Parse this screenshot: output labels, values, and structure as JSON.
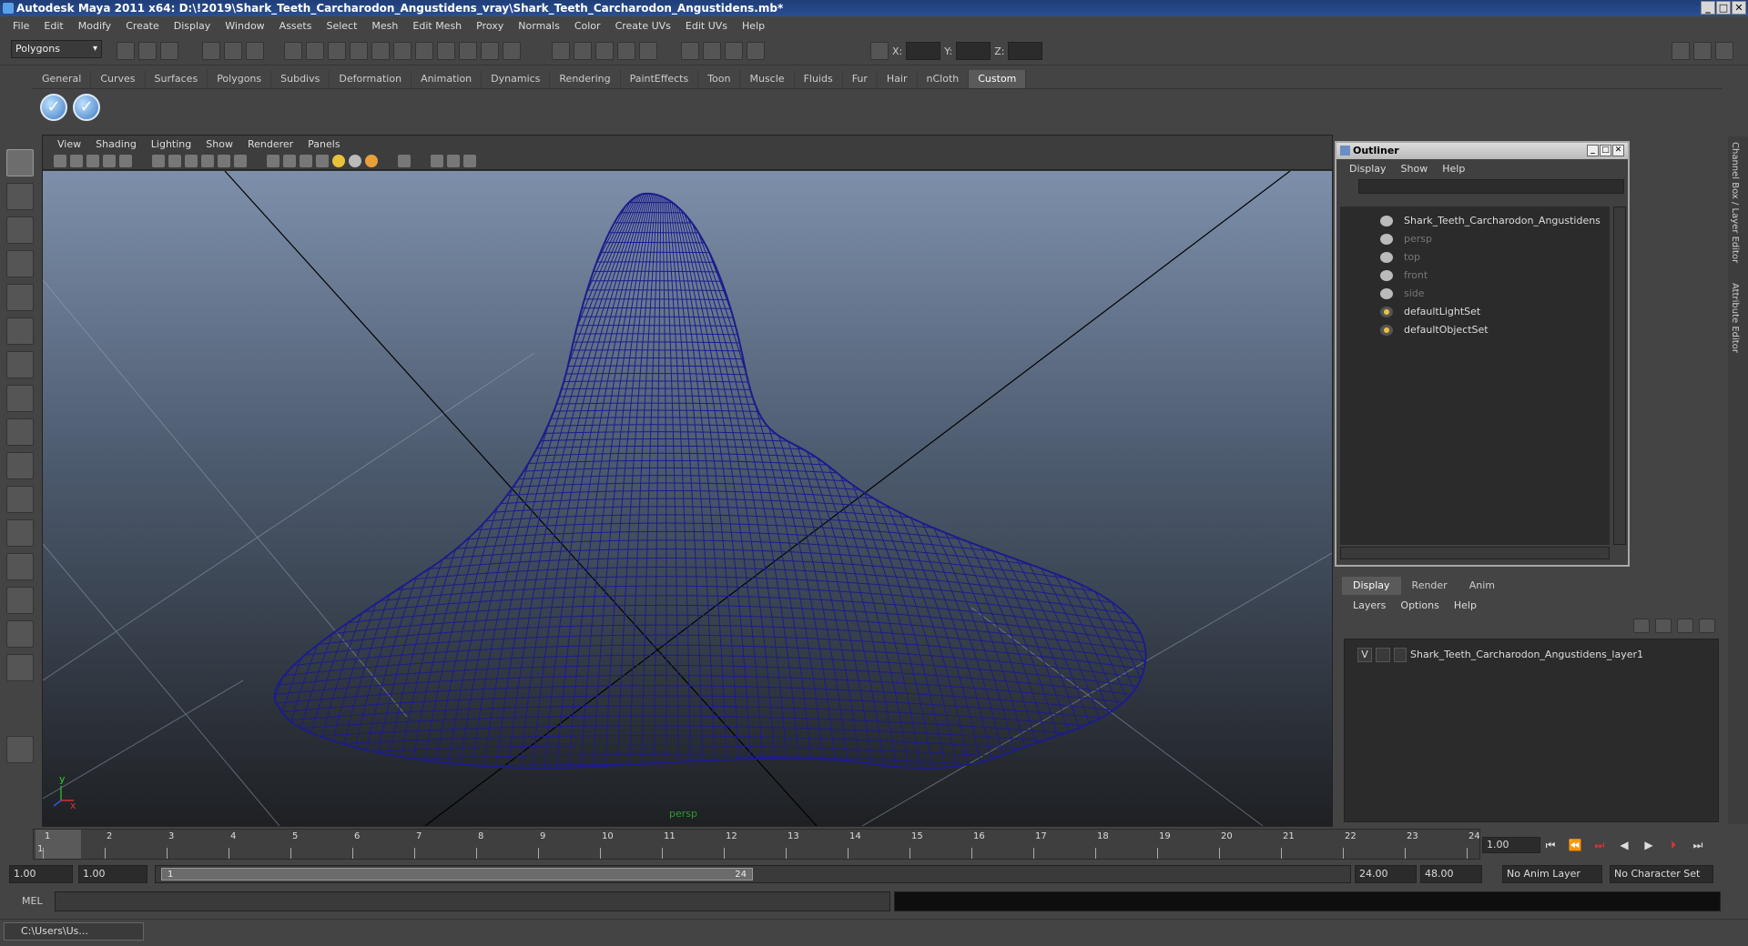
{
  "window": {
    "title": "Autodesk Maya 2011 x64: D:\\!2019\\Shark_Teeth_Carcharodon_Angustidens_vray\\Shark_Teeth_Carcharodon_Angustidens.mb*",
    "min": "_",
    "max": "□",
    "close": "✕"
  },
  "menubar": [
    "File",
    "Edit",
    "Modify",
    "Create",
    "Display",
    "Window",
    "Assets",
    "Select",
    "Mesh",
    "Edit Mesh",
    "Proxy",
    "Normals",
    "Color",
    "Create UVs",
    "Edit UVs",
    "Help"
  ],
  "statusline": {
    "mode": "Polygons",
    "x_label": "X:",
    "y_label": "Y:",
    "z_label": "Z:"
  },
  "shelf": {
    "tabs": [
      "General",
      "Curves",
      "Surfaces",
      "Polygons",
      "Subdivs",
      "Deformation",
      "Animation",
      "Dynamics",
      "Rendering",
      "PaintEffects",
      "Toon",
      "Muscle",
      "Fluids",
      "Fur",
      "Hair",
      "nCloth",
      "Custom"
    ],
    "active_tab": "Custom"
  },
  "viewport": {
    "menu": [
      "View",
      "Shading",
      "Lighting",
      "Show",
      "Renderer",
      "Panels"
    ],
    "camera": "persp",
    "axis_y": "y",
    "axis_x": "x",
    "wire_color": "#1c1c8c"
  },
  "outliner": {
    "title": "Outliner",
    "menu": [
      "Display",
      "Show",
      "Help"
    ],
    "items": [
      {
        "label": "Shark_Teeth_Carcharodon_Angustidens",
        "dim": false
      },
      {
        "label": "persp",
        "dim": true
      },
      {
        "label": "top",
        "dim": true
      },
      {
        "label": "front",
        "dim": true
      },
      {
        "label": "side",
        "dim": true
      },
      {
        "label": "defaultLightSet",
        "dim": false
      },
      {
        "label": "defaultObjectSet",
        "dim": false
      }
    ]
  },
  "layer_editor": {
    "tabs": [
      "Display",
      "Render",
      "Anim"
    ],
    "active_tab": "Display",
    "menu": [
      "Layers",
      "Options",
      "Help"
    ],
    "layers": [
      {
        "visible": "V",
        "name": "Shark_Teeth_Carcharodon_Angustidens_layer1"
      }
    ]
  },
  "side_tabs": [
    "Channel Box / Layer Editor",
    "Attribute Editor"
  ],
  "time_slider": {
    "ticks": [
      "1",
      "2",
      "3",
      "4",
      "5",
      "6",
      "7",
      "8",
      "9",
      "10",
      "11",
      "12",
      "13",
      "14",
      "15",
      "16",
      "17",
      "18",
      "19",
      "20",
      "21",
      "22",
      "23",
      "24"
    ],
    "current_frame": "1.00",
    "playhead_label": "1"
  },
  "playback": [
    "⏮",
    "⏪",
    "⏭",
    "◀",
    "▶",
    "⏵",
    "⏭"
  ],
  "range": {
    "start": "1.00",
    "inner_start": "1.00",
    "thumb_start": "1",
    "thumb_end": "24",
    "end": "24.00",
    "max": "48.00",
    "anim_layer": "No Anim Layer",
    "char_set": "No Character Set"
  },
  "command": {
    "label": "MEL"
  },
  "taskbar": {
    "item": "C:\\Users\\Us..."
  }
}
